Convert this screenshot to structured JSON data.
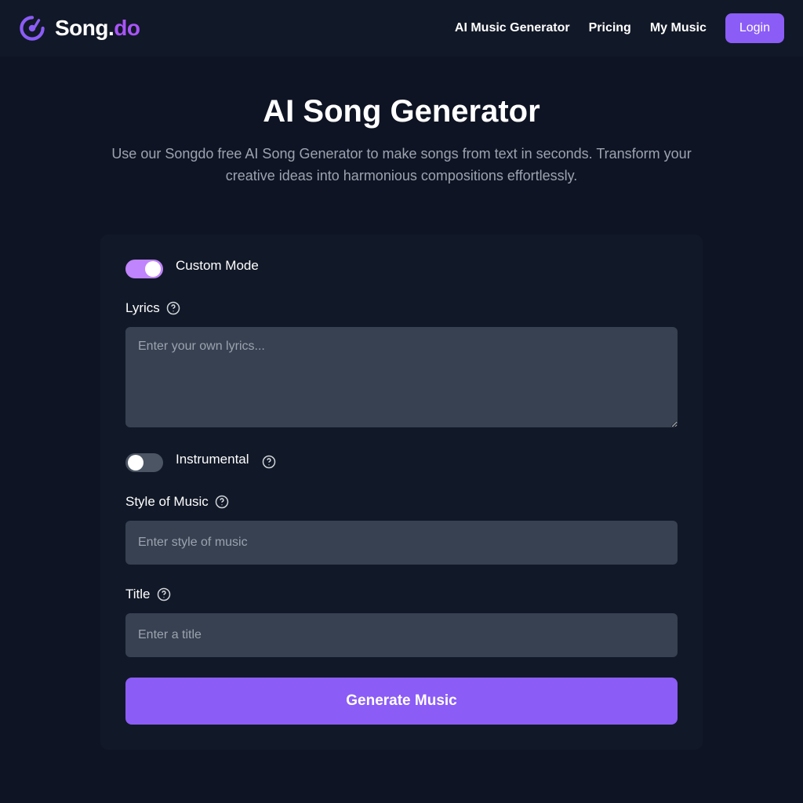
{
  "brand": {
    "part1": "Song.",
    "part2": "do"
  },
  "nav": {
    "links": [
      "AI Music Generator",
      "Pricing",
      "My Music"
    ],
    "login": "Login"
  },
  "hero": {
    "title": "AI Song Generator",
    "subtitle": "Use our Songdo free AI Song Generator to make songs from text in seconds. Transform your creative ideas into harmonious compositions effortlessly."
  },
  "form": {
    "customMode": {
      "label": "Custom Mode",
      "on": true
    },
    "lyrics": {
      "label": "Lyrics",
      "placeholder": "Enter your own lyrics...",
      "value": ""
    },
    "instrumental": {
      "label": "Instrumental",
      "on": false
    },
    "style": {
      "label": "Style of Music",
      "placeholder": "Enter style of music",
      "value": ""
    },
    "title": {
      "label": "Title",
      "placeholder": "Enter a title",
      "value": ""
    },
    "submit": "Generate Music"
  },
  "colors": {
    "accent": "#8b5cf6",
    "toggleOn": "#c084fc"
  }
}
